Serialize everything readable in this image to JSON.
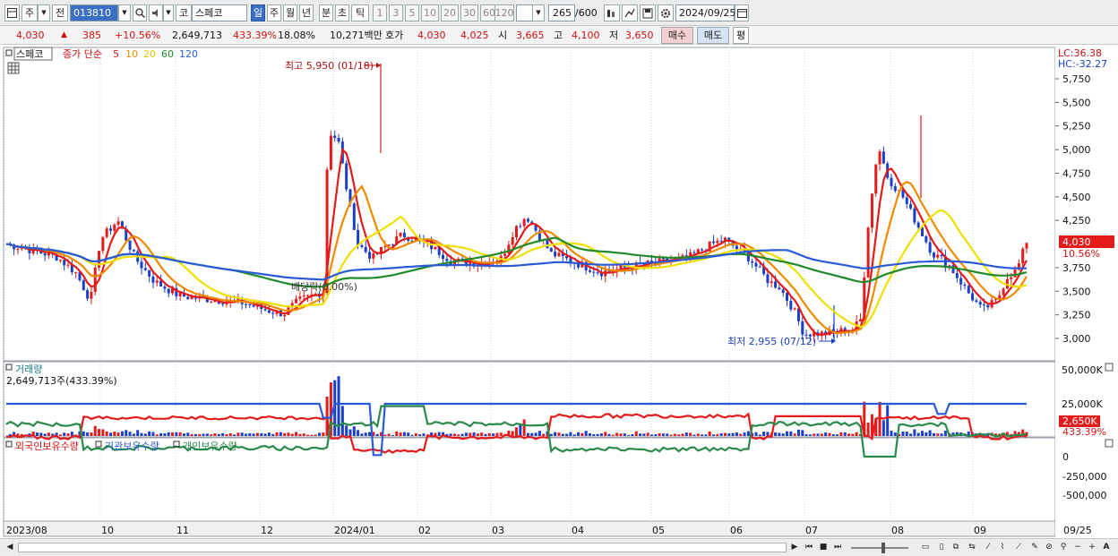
{
  "toolbar": {
    "market_label": "주",
    "prev_label": "전",
    "stock_code": "013810",
    "market_prefix": "코",
    "stock_name": "스페코",
    "periods": [
      "일",
      "주",
      "월",
      "년",
      "분",
      "초",
      "틱"
    ],
    "active_period": "일",
    "intervals": [
      "1",
      "3",
      "5",
      "10",
      "20",
      "30",
      "60",
      "120"
    ],
    "count_display": "265",
    "count_total": "/600",
    "date": "2024/09/25"
  },
  "quote": {
    "price": "4,030",
    "change": "385",
    "change_pct": "+10.56%",
    "volume": "2,649,713",
    "volume_pct": "433.39%",
    "turnover": "18.08%",
    "amount": "10,271백만",
    "hoga_label": "호가",
    "hoga_ask": "4,030",
    "hoga_bid": "4,025",
    "open_label": "시",
    "open": "3,665",
    "high_label": "고",
    "high": "4,100",
    "low_label": "저",
    "low": "3,650",
    "buy_button": "매수",
    "sell_button": "매도",
    "eval_button": "평"
  },
  "price_panel": {
    "stock_tag": "스페코",
    "legend_prefix": "종가 단순",
    "ma_labels": [
      {
        "label": "5",
        "color": "#e31b1b"
      },
      {
        "label": "10",
        "color": "#f08a00"
      },
      {
        "label": "20",
        "color": "#f0e000"
      },
      {
        "label": "60",
        "color": "#1e8a2a"
      },
      {
        "label": "120",
        "color": "#2a5ad8"
      }
    ],
    "lc_label": "LC:36.38",
    "hc_label": "HC:-32.27",
    "y_ticks": [
      "5,750",
      "5,500",
      "5,250",
      "5,000",
      "4,750",
      "4,500",
      "4,250",
      "3,750",
      "3,500",
      "3,250",
      "3,000"
    ],
    "current_price_tag": "4,030",
    "current_pct_tag": "10.56%",
    "high_annotation": "최고 5,950 (01/18)",
    "low_annotation": "최저 2,955 (07/12)",
    "dividend_annotation": "배당락(0.00%)"
  },
  "volume_panel": {
    "title": "거래량",
    "value": "2,649,713주(433.39%)",
    "y_ticks": [
      "50,000K",
      "25,000K"
    ],
    "current_tag": "2,650K",
    "current_pct": "433.39%"
  },
  "holding_panel": {
    "legend": [
      {
        "label": "외국인보유수량",
        "color": "#e31b1b"
      },
      {
        "label": "기관보유수량",
        "color": "#2a5ad8"
      },
      {
        "label": "개인보유수량",
        "color": "#2a8a4a"
      }
    ],
    "y_ticks": [
      "0",
      "-250,000",
      "-500,000"
    ]
  },
  "x_axis": [
    "2023/08",
    "10",
    "11",
    "12",
    "2024/01",
    "02",
    "03",
    "04",
    "05",
    "06",
    "07",
    "08",
    "09",
    "09/25"
  ],
  "colors": {
    "up": "#e31b1b",
    "down": "#1a3fc8",
    "ma5": "#e31b1b",
    "ma10": "#f08a00",
    "ma20": "#f0e000",
    "ma60": "#1e8a2a",
    "ma120": "#2a5ad8"
  }
}
